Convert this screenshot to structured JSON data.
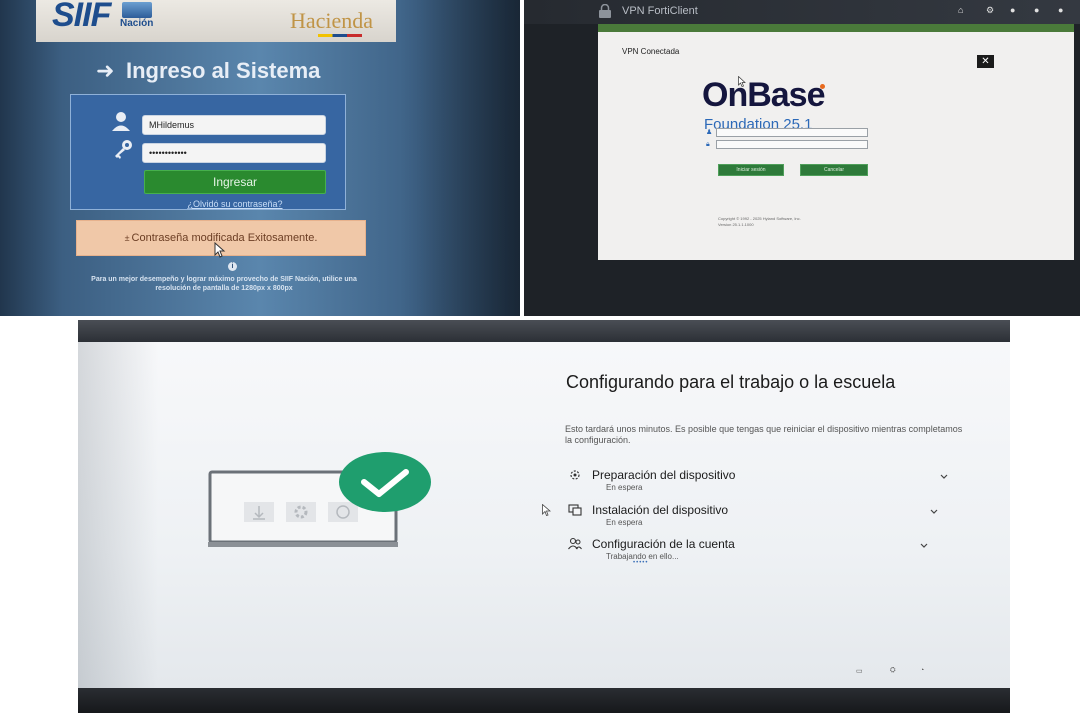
{
  "siif": {
    "logo_text": "SIIF",
    "logo_subtext": "Nación",
    "brand": "Hacienda",
    "title": "Ingreso al Sistema",
    "username_value": "MHildemus",
    "password_value": "••••••••••••",
    "login_button": "Ingresar",
    "forgot_link": "¿Olvidó su contraseña?",
    "notice": "Contraseña modificada Exitosamente.",
    "footnote_line1": "Para un mejor desempeño y lograr máximo provecho de SIIF Nación, utilice una",
    "footnote_line2": "resolución de pantalla de 1280px x 800px"
  },
  "vpn": {
    "window_title": "VPN FortiClient",
    "status": "VPN Conectada",
    "product_name": "OnBase",
    "product_version": "Foundation 25.1",
    "login_button": "Iniciar sesión",
    "cancel_button": "Cancelar",
    "copyright_line1": "Copyright © 1992 - 2025 Hyland Software, Inc.",
    "copyright_line2": "Version 25.1.1.1000"
  },
  "windows_setup": {
    "heading": "Configurando para el trabajo o la escuela",
    "subtext": "Esto tardará unos minutos. Es posible que tengas que reiniciar el dispositivo mientras completamos la configuración.",
    "steps": [
      {
        "label": "Preparación del dispositivo",
        "status": "En espera",
        "icon": "device-prep-icon"
      },
      {
        "label": "Instalación del dispositivo",
        "status": "En espera",
        "icon": "device-setup-icon"
      },
      {
        "label": "Configuración de la cuenta",
        "status": "Trabajando en ello...",
        "icon": "account-icon"
      }
    ],
    "progress_dots": "•••••"
  },
  "colors": {
    "siif_green": "#2a8a2f",
    "siif_blue": "#3766a2",
    "notice_bg": "#f0c8a8",
    "onbase_navy": "#15163e",
    "onbase_blue": "#2c69b8",
    "windows_check": "#1f9e6e"
  }
}
